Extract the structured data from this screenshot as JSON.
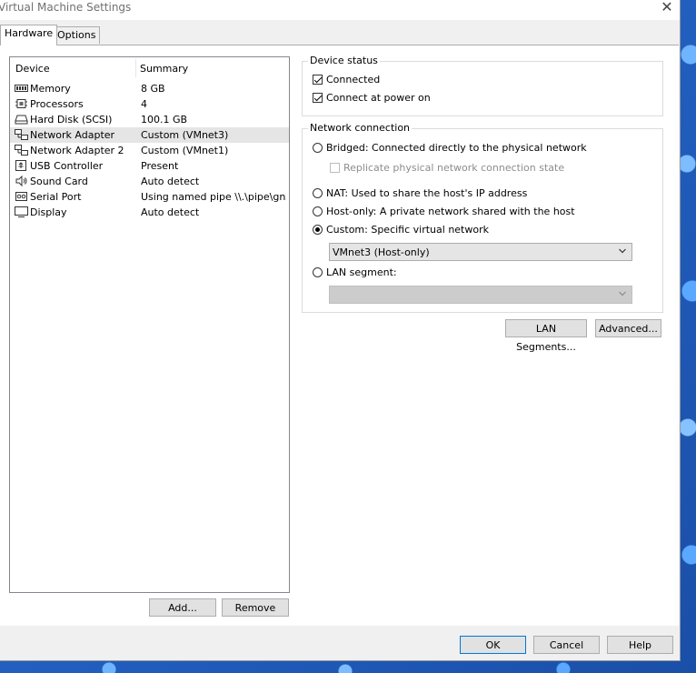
{
  "window": {
    "title": "Virtual Machine Settings"
  },
  "tabs": [
    {
      "label": "Hardware",
      "active": true
    },
    {
      "label": "Options",
      "active": false
    }
  ],
  "devices": {
    "header": {
      "device": "Device",
      "summary": "Summary"
    },
    "rows": [
      {
        "name": "Memory",
        "summary": "8 GB",
        "icon": "memory-icon"
      },
      {
        "name": "Processors",
        "summary": "4",
        "icon": "processor-icon"
      },
      {
        "name": "Hard Disk (SCSI)",
        "summary": "100.1 GB",
        "icon": "hard-disk-icon"
      },
      {
        "name": "Network Adapter",
        "summary": "Custom (VMnet3)",
        "icon": "network-adapter-icon",
        "selected": true
      },
      {
        "name": "Network Adapter 2",
        "summary": "Custom (VMnet1)",
        "icon": "network-adapter-icon"
      },
      {
        "name": "USB Controller",
        "summary": "Present",
        "icon": "usb-icon"
      },
      {
        "name": "Sound Card",
        "summary": "Auto detect",
        "icon": "speaker-icon"
      },
      {
        "name": "Serial Port",
        "summary": "Using named pipe \\\\.\\pipe\\gns...",
        "icon": "serial-port-icon"
      },
      {
        "name": "Display",
        "summary": "Auto detect",
        "icon": "monitor-icon"
      }
    ],
    "add_label": "Add...",
    "remove_label": "Remove"
  },
  "device_status": {
    "title": "Device status",
    "connected_label": "Connected",
    "connected": true,
    "power_on_label": "Connect at power on",
    "power_on": true
  },
  "network": {
    "title": "Network connection",
    "bridged_label": "Bridged: Connected directly to the physical network",
    "replicate_label": "Replicate physical network connection state",
    "nat_label": "NAT: Used to share the host's IP address",
    "hostonly_label": "Host-only: A private network shared with the host",
    "custom_label": "Custom: Specific virtual network",
    "custom_value": "VMnet3 (Host-only)",
    "lan_label": "LAN segment:",
    "lan_value": "",
    "selected": "custom",
    "lan_segments_button": "LAN Segments...",
    "advanced_button": "Advanced..."
  },
  "footer": {
    "ok_label": "OK",
    "cancel_label": "Cancel",
    "help_label": "Help"
  }
}
